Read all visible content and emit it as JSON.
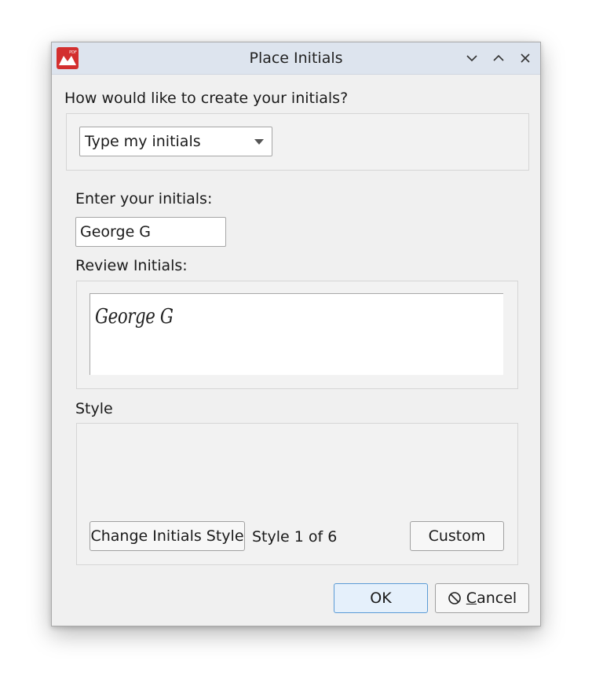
{
  "window": {
    "title": "Place Initials",
    "app_icon_badge": "PDF"
  },
  "creation": {
    "question": "How would like to create your initials?",
    "method_selected": "Type my initials"
  },
  "initials": {
    "label": "Enter your initials:",
    "value": "George G"
  },
  "review": {
    "label": "Review Initials:",
    "preview_text": "George G"
  },
  "style": {
    "label": "Style",
    "change_button": "Change Initials Style",
    "status": "Style 1 of 6",
    "custom_button": "Custom"
  },
  "footer": {
    "ok_label": "OK",
    "cancel_mnemonic": "C",
    "cancel_rest": "ancel"
  },
  "colors": {
    "titlebar": "#dde4ee",
    "app_icon": "#d32f2f",
    "default_button_border": "#5b9bd5"
  }
}
